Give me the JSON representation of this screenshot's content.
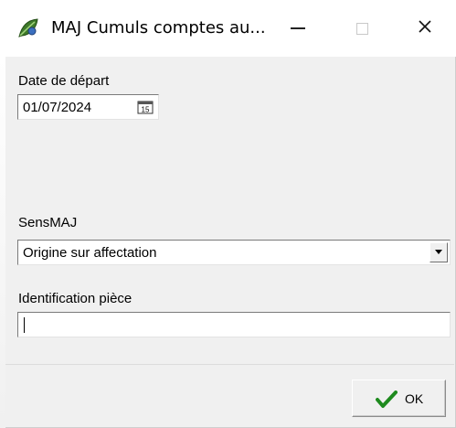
{
  "window": {
    "title": "MAJ Cumuls comptes au...",
    "app_icon": "app-leaf-icon",
    "controls": {
      "minimize_icon": "minimize-icon",
      "maximize_icon": "maximize-icon",
      "close_icon": "close-icon",
      "close_glyph": "✕"
    }
  },
  "form": {
    "date_label": "Date de départ",
    "date_value": "01/07/2024",
    "calendar_icon": "calendar-icon",
    "sens_label": "SensMAJ",
    "sens_value": "Origine sur affectation",
    "dropdown_icon": "chevron-down-icon",
    "ident_label": "Identification pièce",
    "ident_value": ""
  },
  "footer": {
    "ok_label": "OK",
    "ok_icon": "checkmark-icon"
  },
  "colors": {
    "title_bg": "#ffffff",
    "dialog_bg": "#f0f0f0",
    "ok_check": "#1e8a1e"
  }
}
